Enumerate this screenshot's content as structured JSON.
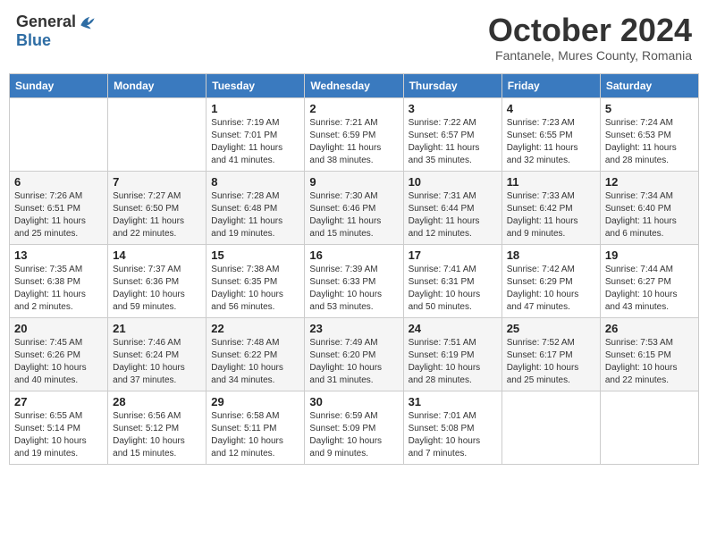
{
  "header": {
    "logo_general": "General",
    "logo_blue": "Blue",
    "month_title": "October 2024",
    "subtitle": "Fantanele, Mures County, Romania"
  },
  "days_of_week": [
    "Sunday",
    "Monday",
    "Tuesday",
    "Wednesday",
    "Thursday",
    "Friday",
    "Saturday"
  ],
  "weeks": [
    [
      {
        "day": "",
        "info": ""
      },
      {
        "day": "",
        "info": ""
      },
      {
        "day": "1",
        "info": "Sunrise: 7:19 AM\nSunset: 7:01 PM\nDaylight: 11 hours and 41 minutes."
      },
      {
        "day": "2",
        "info": "Sunrise: 7:21 AM\nSunset: 6:59 PM\nDaylight: 11 hours and 38 minutes."
      },
      {
        "day": "3",
        "info": "Sunrise: 7:22 AM\nSunset: 6:57 PM\nDaylight: 11 hours and 35 minutes."
      },
      {
        "day": "4",
        "info": "Sunrise: 7:23 AM\nSunset: 6:55 PM\nDaylight: 11 hours and 32 minutes."
      },
      {
        "day": "5",
        "info": "Sunrise: 7:24 AM\nSunset: 6:53 PM\nDaylight: 11 hours and 28 minutes."
      }
    ],
    [
      {
        "day": "6",
        "info": "Sunrise: 7:26 AM\nSunset: 6:51 PM\nDaylight: 11 hours and 25 minutes."
      },
      {
        "day": "7",
        "info": "Sunrise: 7:27 AM\nSunset: 6:50 PM\nDaylight: 11 hours and 22 minutes."
      },
      {
        "day": "8",
        "info": "Sunrise: 7:28 AM\nSunset: 6:48 PM\nDaylight: 11 hours and 19 minutes."
      },
      {
        "day": "9",
        "info": "Sunrise: 7:30 AM\nSunset: 6:46 PM\nDaylight: 11 hours and 15 minutes."
      },
      {
        "day": "10",
        "info": "Sunrise: 7:31 AM\nSunset: 6:44 PM\nDaylight: 11 hours and 12 minutes."
      },
      {
        "day": "11",
        "info": "Sunrise: 7:33 AM\nSunset: 6:42 PM\nDaylight: 11 hours and 9 minutes."
      },
      {
        "day": "12",
        "info": "Sunrise: 7:34 AM\nSunset: 6:40 PM\nDaylight: 11 hours and 6 minutes."
      }
    ],
    [
      {
        "day": "13",
        "info": "Sunrise: 7:35 AM\nSunset: 6:38 PM\nDaylight: 11 hours and 2 minutes."
      },
      {
        "day": "14",
        "info": "Sunrise: 7:37 AM\nSunset: 6:36 PM\nDaylight: 10 hours and 59 minutes."
      },
      {
        "day": "15",
        "info": "Sunrise: 7:38 AM\nSunset: 6:35 PM\nDaylight: 10 hours and 56 minutes."
      },
      {
        "day": "16",
        "info": "Sunrise: 7:39 AM\nSunset: 6:33 PM\nDaylight: 10 hours and 53 minutes."
      },
      {
        "day": "17",
        "info": "Sunrise: 7:41 AM\nSunset: 6:31 PM\nDaylight: 10 hours and 50 minutes."
      },
      {
        "day": "18",
        "info": "Sunrise: 7:42 AM\nSunset: 6:29 PM\nDaylight: 10 hours and 47 minutes."
      },
      {
        "day": "19",
        "info": "Sunrise: 7:44 AM\nSunset: 6:27 PM\nDaylight: 10 hours and 43 minutes."
      }
    ],
    [
      {
        "day": "20",
        "info": "Sunrise: 7:45 AM\nSunset: 6:26 PM\nDaylight: 10 hours and 40 minutes."
      },
      {
        "day": "21",
        "info": "Sunrise: 7:46 AM\nSunset: 6:24 PM\nDaylight: 10 hours and 37 minutes."
      },
      {
        "day": "22",
        "info": "Sunrise: 7:48 AM\nSunset: 6:22 PM\nDaylight: 10 hours and 34 minutes."
      },
      {
        "day": "23",
        "info": "Sunrise: 7:49 AM\nSunset: 6:20 PM\nDaylight: 10 hours and 31 minutes."
      },
      {
        "day": "24",
        "info": "Sunrise: 7:51 AM\nSunset: 6:19 PM\nDaylight: 10 hours and 28 minutes."
      },
      {
        "day": "25",
        "info": "Sunrise: 7:52 AM\nSunset: 6:17 PM\nDaylight: 10 hours and 25 minutes."
      },
      {
        "day": "26",
        "info": "Sunrise: 7:53 AM\nSunset: 6:15 PM\nDaylight: 10 hours and 22 minutes."
      }
    ],
    [
      {
        "day": "27",
        "info": "Sunrise: 6:55 AM\nSunset: 5:14 PM\nDaylight: 10 hours and 19 minutes."
      },
      {
        "day": "28",
        "info": "Sunrise: 6:56 AM\nSunset: 5:12 PM\nDaylight: 10 hours and 15 minutes."
      },
      {
        "day": "29",
        "info": "Sunrise: 6:58 AM\nSunset: 5:11 PM\nDaylight: 10 hours and 12 minutes."
      },
      {
        "day": "30",
        "info": "Sunrise: 6:59 AM\nSunset: 5:09 PM\nDaylight: 10 hours and 9 minutes."
      },
      {
        "day": "31",
        "info": "Sunrise: 7:01 AM\nSunset: 5:08 PM\nDaylight: 10 hours and 7 minutes."
      },
      {
        "day": "",
        "info": ""
      },
      {
        "day": "",
        "info": ""
      }
    ]
  ]
}
